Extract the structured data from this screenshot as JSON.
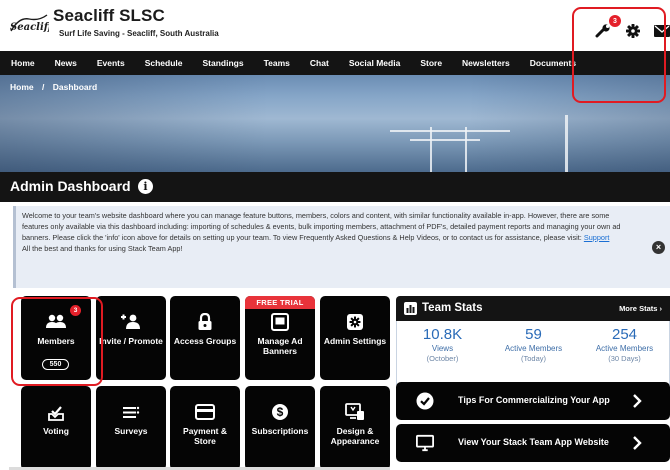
{
  "header": {
    "club_name": "Seacliff SLSC",
    "club_subtitle": "Surf Life Saving - Seacliff, South Australia",
    "logo_text": "Seacliff",
    "tools_badge": "3",
    "icons": [
      "wrench-icon",
      "gear-icon",
      "envelope-icon"
    ]
  },
  "nav": {
    "items": [
      "Home",
      "News",
      "Events",
      "Schedule",
      "Standings",
      "Teams",
      "Chat",
      "Social Media",
      "Store",
      "Newsletters",
      "Documents"
    ]
  },
  "breadcrumb": {
    "home": "Home",
    "separator": "/",
    "current": "Dashboard"
  },
  "admin": {
    "title": "Admin Dashboard"
  },
  "notice": {
    "text": "Welcome to your team's website dashboard where you can manage feature buttons, members, colors and content, with similar functionality available in-app. However, there are some features only available via this dashboard including: importing of schedules & events, bulk importing members, attachment of PDF's, detailed payment reports and managing your own ad banners. Please click the 'info' icon above for details on setting up your team. To view Frequently Asked Questions & Help Videos, or to contact us for assistance, please visit: ",
    "link": "Support",
    "closing": "All the best and thanks for using Stack Team App!"
  },
  "tiles": [
    {
      "label": "Members",
      "badge": "3",
      "count": "550",
      "icon": "members-icon"
    },
    {
      "label": "Invite / Promote",
      "icon": "invite-icon"
    },
    {
      "label": "Access Groups",
      "icon": "lock-icon"
    },
    {
      "label": "Manage Ad Banners",
      "ribbon": "FREE TRIAL",
      "icon": "ad-banner-icon"
    },
    {
      "label": "Admin Settings",
      "icon": "settings-icon"
    },
    {
      "label": "Voting",
      "icon": "voting-icon"
    },
    {
      "label": "Surveys",
      "icon": "survey-icon"
    },
    {
      "label": "Payment & Store",
      "icon": "card-icon"
    },
    {
      "label": "Subscriptions",
      "icon": "dollar-icon"
    },
    {
      "label": "Design & Appearance",
      "icon": "design-icon"
    }
  ],
  "team_stats": {
    "title": "Team Stats",
    "more": "More Stats",
    "stats": [
      {
        "value": "10.8K",
        "label": "Views",
        "sub": "(October)"
      },
      {
        "value": "59",
        "label": "Active Members",
        "sub": "(Today)"
      },
      {
        "value": "254",
        "label": "Active Members",
        "sub": "(30 Days)"
      }
    ]
  },
  "actions": [
    {
      "label": "Tips For Commercializing Your App",
      "icon": "check-circle-icon"
    },
    {
      "label": "View Your Stack Team App Website",
      "icon": "monitor-icon"
    }
  ],
  "colors": {
    "accent_red": "#e4202a",
    "dark": "#141414",
    "stat_blue": "#2a6bb8",
    "link_blue": "#1a6fd4"
  }
}
